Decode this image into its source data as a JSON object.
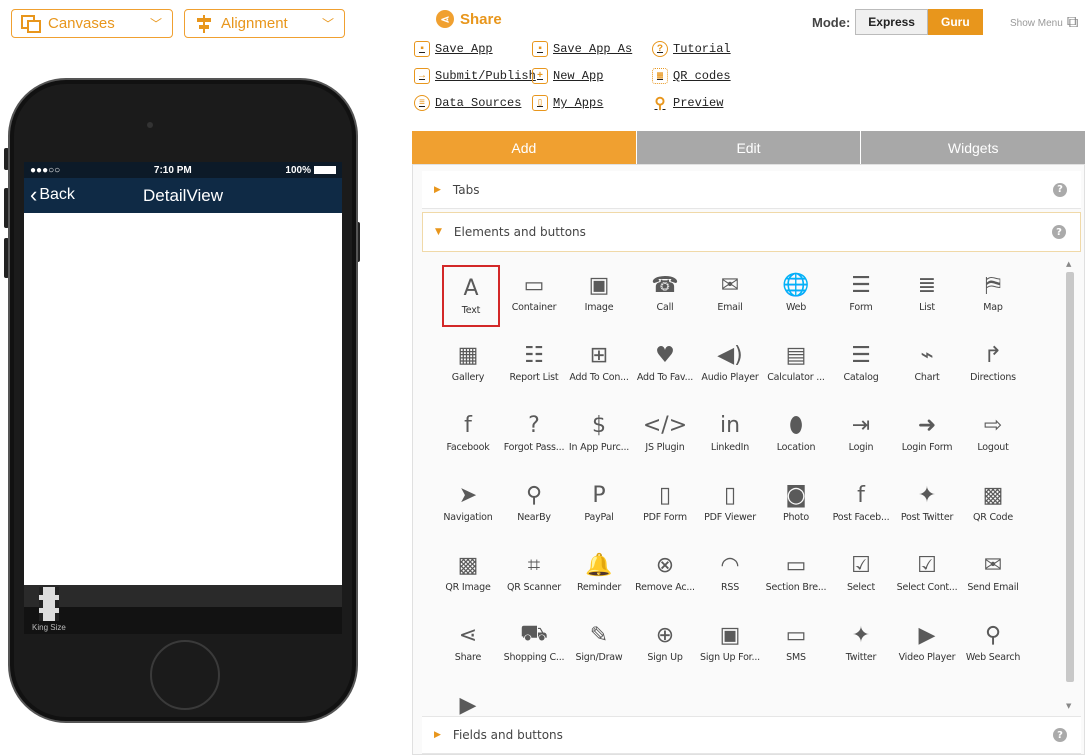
{
  "toolbar": {
    "canvases_label": "Canvases",
    "alignment_label": "Alignment"
  },
  "phone": {
    "carrier": "●●●○○",
    "time": "7:10 PM",
    "battery": "100%",
    "back_label": "Back",
    "nav_title": "DetailView",
    "tab_label": "King Size"
  },
  "header": {
    "share_label": "Share",
    "mode_label": "Mode:",
    "mode_express": "Express",
    "mode_guru": "Guru",
    "show_menu": "Show Menu"
  },
  "links": [
    {
      "label": "Save App",
      "icon": "save-icon"
    },
    {
      "label": "Save App As",
      "icon": "save-as-icon"
    },
    {
      "label": "Tutorial",
      "icon": "help-icon"
    },
    {
      "label": "Submit/Publish",
      "icon": "submit-icon"
    },
    {
      "label": "New App",
      "icon": "plus-icon"
    },
    {
      "label": "QR codes",
      "icon": "qr-icon"
    },
    {
      "label": "Data Sources",
      "icon": "database-icon"
    },
    {
      "label": "My Apps",
      "icon": "apps-icon"
    },
    {
      "label": "Preview",
      "icon": "search-icon"
    }
  ],
  "tabs": [
    "Add",
    "Edit",
    "Widgets"
  ],
  "sections": {
    "tabs": "Tabs",
    "elements": "Elements and buttons",
    "fields": "Fields and buttons"
  },
  "elements": [
    {
      "label": "Text",
      "icon": "A"
    },
    {
      "label": "Container",
      "icon": "▭"
    },
    {
      "label": "Image",
      "icon": "▣"
    },
    {
      "label": "Call",
      "icon": "☎"
    },
    {
      "label": "Email",
      "icon": "✉"
    },
    {
      "label": "Web",
      "icon": "🌐"
    },
    {
      "label": "Form",
      "icon": "☰"
    },
    {
      "label": "List",
      "icon": "≣"
    },
    {
      "label": "Map",
      "icon": "⛿"
    },
    {
      "label": "Gallery",
      "icon": "▦"
    },
    {
      "label": "Report List",
      "icon": "☷"
    },
    {
      "label": "Add To Con...",
      "icon": "⊞"
    },
    {
      "label": "Add To Fav...",
      "icon": "♥"
    },
    {
      "label": "Audio Player",
      "icon": "◀)"
    },
    {
      "label": "Calculator ...",
      "icon": "▤"
    },
    {
      "label": "Catalog",
      "icon": "☰"
    },
    {
      "label": "Chart",
      "icon": "⌁"
    },
    {
      "label": "Directions",
      "icon": "↱"
    },
    {
      "label": "Facebook",
      "icon": "f"
    },
    {
      "label": "Forgot Pass...",
      "icon": "?"
    },
    {
      "label": "In App Purc...",
      "icon": "$"
    },
    {
      "label": "JS Plugin",
      "icon": "</>"
    },
    {
      "label": "LinkedIn",
      "icon": "in"
    },
    {
      "label": "Location",
      "icon": "⬮"
    },
    {
      "label": "Login",
      "icon": "⇥"
    },
    {
      "label": "Login Form",
      "icon": "➜"
    },
    {
      "label": "Logout",
      "icon": "⇨"
    },
    {
      "label": "Navigation",
      "icon": "➤"
    },
    {
      "label": "NearBy",
      "icon": "⚲"
    },
    {
      "label": "PayPal",
      "icon": "P"
    },
    {
      "label": "PDF Form",
      "icon": "▯"
    },
    {
      "label": "PDF Viewer",
      "icon": "▯"
    },
    {
      "label": "Photo",
      "icon": "◙"
    },
    {
      "label": "Post Faceb...",
      "icon": "f"
    },
    {
      "label": "Post Twitter",
      "icon": "✦"
    },
    {
      "label": "QR Code",
      "icon": "▩"
    },
    {
      "label": "QR Image",
      "icon": "▩"
    },
    {
      "label": "QR Scanner",
      "icon": "⌗"
    },
    {
      "label": "Reminder",
      "icon": "🔔"
    },
    {
      "label": "Remove Ac...",
      "icon": "⊗"
    },
    {
      "label": "RSS",
      "icon": "◠"
    },
    {
      "label": "Section Bre...",
      "icon": "▭"
    },
    {
      "label": "Select",
      "icon": "☑"
    },
    {
      "label": "Select Cont...",
      "icon": "☑"
    },
    {
      "label": "Send Email",
      "icon": "✉"
    },
    {
      "label": "Share",
      "icon": "⋖"
    },
    {
      "label": "Shopping C...",
      "icon": "⛟"
    },
    {
      "label": "Sign/Draw",
      "icon": "✎"
    },
    {
      "label": "Sign Up",
      "icon": "⊕"
    },
    {
      "label": "Sign Up For...",
      "icon": "▣"
    },
    {
      "label": "SMS",
      "icon": "▭"
    },
    {
      "label": "Twitter",
      "icon": "✦"
    },
    {
      "label": "Video Player",
      "icon": "▶"
    },
    {
      "label": "Web Search",
      "icon": "⚲"
    },
    {
      "label": "",
      "icon": "▶"
    }
  ]
}
